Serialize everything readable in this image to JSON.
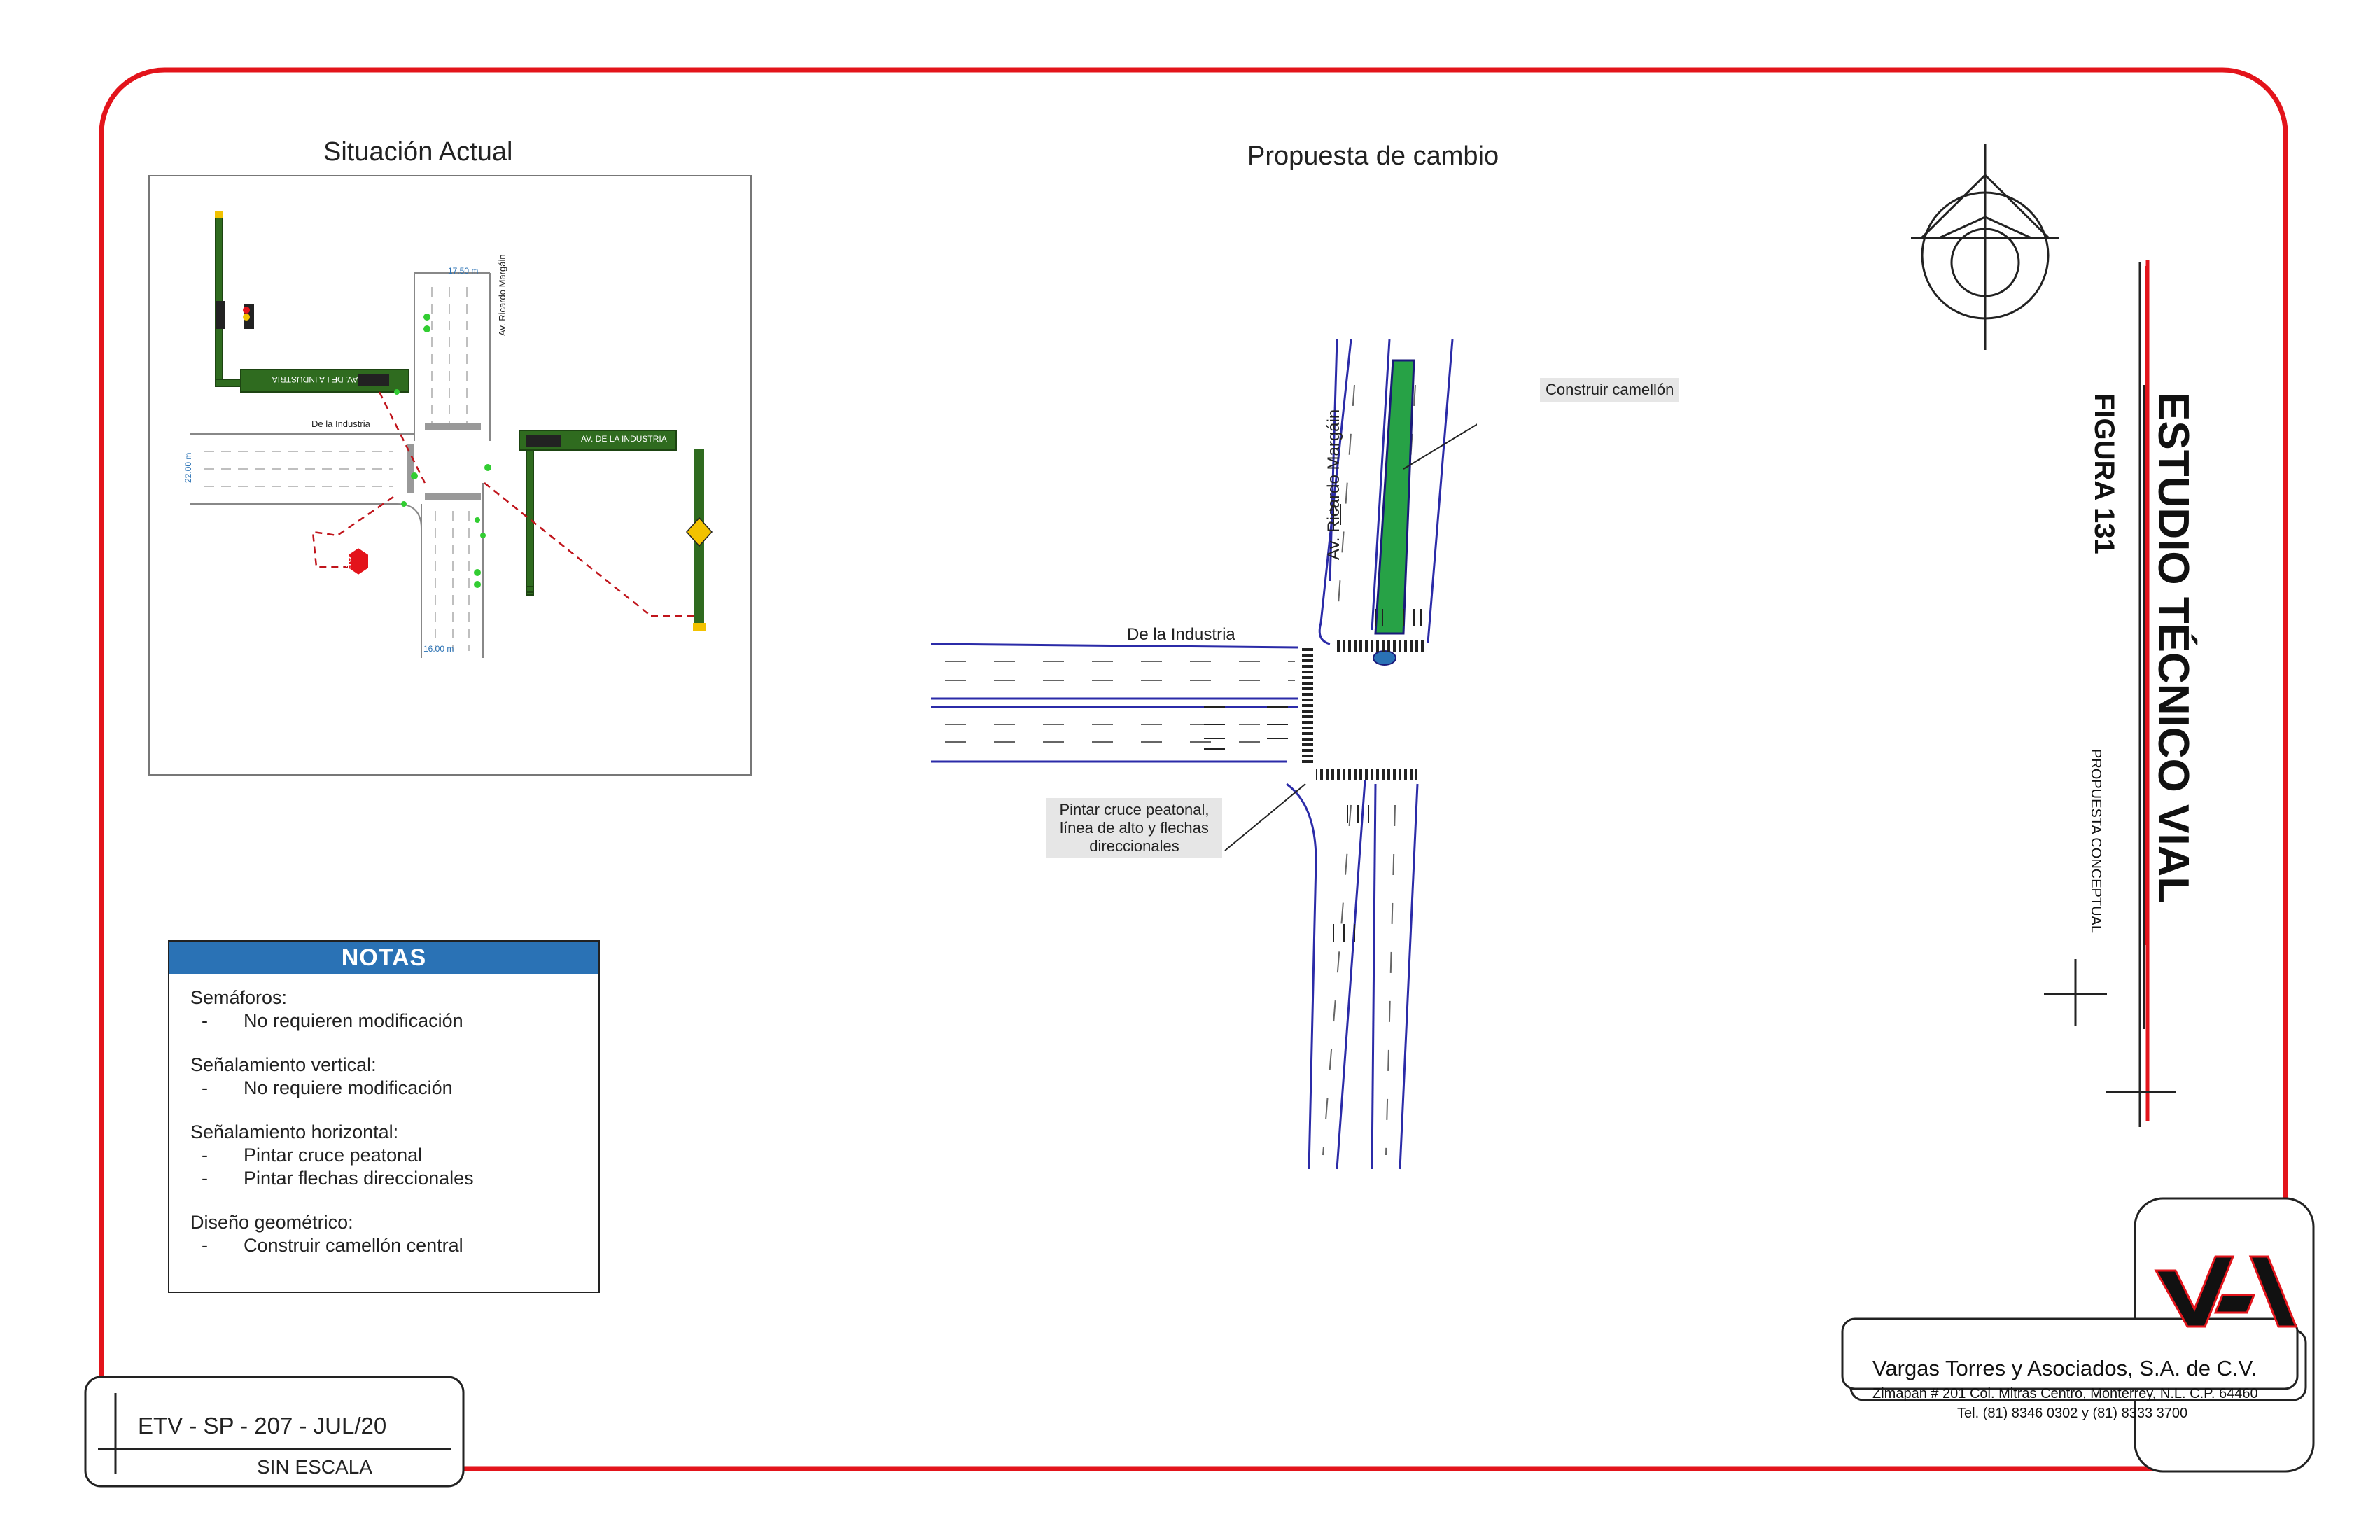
{
  "titles": {
    "actual": "Situación Actual",
    "propuesta": "Propuesta de cambio"
  },
  "sidebar": {
    "main_title": "ESTUDIO TÉCNICO VIAL",
    "figure": "FIGURA 131",
    "subtitle": "PROPUESTA CONCEPTUAL"
  },
  "current_plan": {
    "street_west": "De la Industria",
    "street_north": "Av. Ricardo Margáin",
    "sign_1": "AV. DE LA INDUSTRIA",
    "sign_2": "AV. DE LA INDUSTRIA",
    "stop_sign": "ALTO",
    "dim_top": "17.50 m",
    "dim_bottom": "16.00 m",
    "dim_left": "22.00 m"
  },
  "proposal": {
    "street_west": "De la Industria",
    "street_north": "Av.  Ricardo Margáin",
    "callout_1": "Construir camellón",
    "callout_2_lines": [
      "Pintar cruce peatonal,",
      "línea de alto y flechas",
      "direccionales"
    ]
  },
  "notes": {
    "header": "NOTAS",
    "groups": [
      {
        "title": "Semáforos:",
        "items": [
          "No requieren modificación"
        ]
      },
      {
        "title": "Señalamiento vertical:",
        "items": [
          "No requiere modificación"
        ]
      },
      {
        "title": "Señalamiento horizontal:",
        "items": [
          "Pintar cruce peatonal",
          "Pintar flechas direccionales"
        ]
      },
      {
        "title": "Diseño geométrico:",
        "items": [
          "Construir camellón central"
        ]
      }
    ],
    "dash": "-"
  },
  "footer": {
    "code": "ETV - SP - 207 - JUL/20",
    "scale": "SIN ESCALA"
  },
  "company": {
    "name": "Vargas Torres y Asociados, S.A. de C.V.",
    "address": "Zimapan # 201 Col. Mitras Centro, Monterrey, N.L. C.P. 64460",
    "phone": "Tel. (81) 8346 0302  y  (81) 8333 3700"
  },
  "colors": {
    "border_red": "#e3141b",
    "road_blue": "#2b2ba8",
    "median_green": "#27a246",
    "notes_blue": "#2a72b5",
    "signal_green": "#2f6b1f"
  }
}
